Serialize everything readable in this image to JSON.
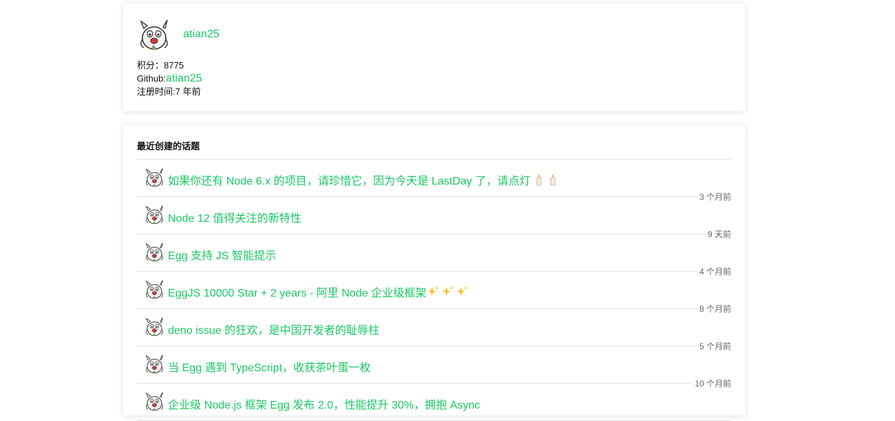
{
  "profile": {
    "username": "atian25",
    "score_label": "积分：",
    "score_value": "8775",
    "github_label": "Github:",
    "github_handle": "atian25",
    "register_label": "注册时间:",
    "register_value": "7 年前"
  },
  "topics": {
    "section_title": "最近创建的话题",
    "items": [
      {
        "title": "如果你还有 Node 6.x 的项目，请珍惜它，因为今天是 LastDay 了，请点灯",
        "time": "3 个月前",
        "suffix_icon": "candle-icon"
      },
      {
        "title": "Node 12 值得关注的新特性",
        "time": "9 天前"
      },
      {
        "title": "Egg 支持 JS 智能提示",
        "time": "4 个月前"
      },
      {
        "title": "EggJS 10000 Star + 2 years - 阿里 Node 企业级框架",
        "time": "8 个月前",
        "suffix_icon": "sparkles-icon"
      },
      {
        "title": "deno issue 的狂欢，是中国开发者的耻辱柱",
        "time": "5 个月前"
      },
      {
        "title": "当 Egg 遇到 TypeScript，收获茶叶蛋一枚",
        "time": "10 个月前"
      },
      {
        "title": "企业级 Node.js 框架 Egg 发布 2.0，性能提升 30%，拥抱 Async",
        "time": ""
      }
    ]
  },
  "colors": {
    "accent": "#1bc864",
    "divider": "#e2e2e2"
  }
}
